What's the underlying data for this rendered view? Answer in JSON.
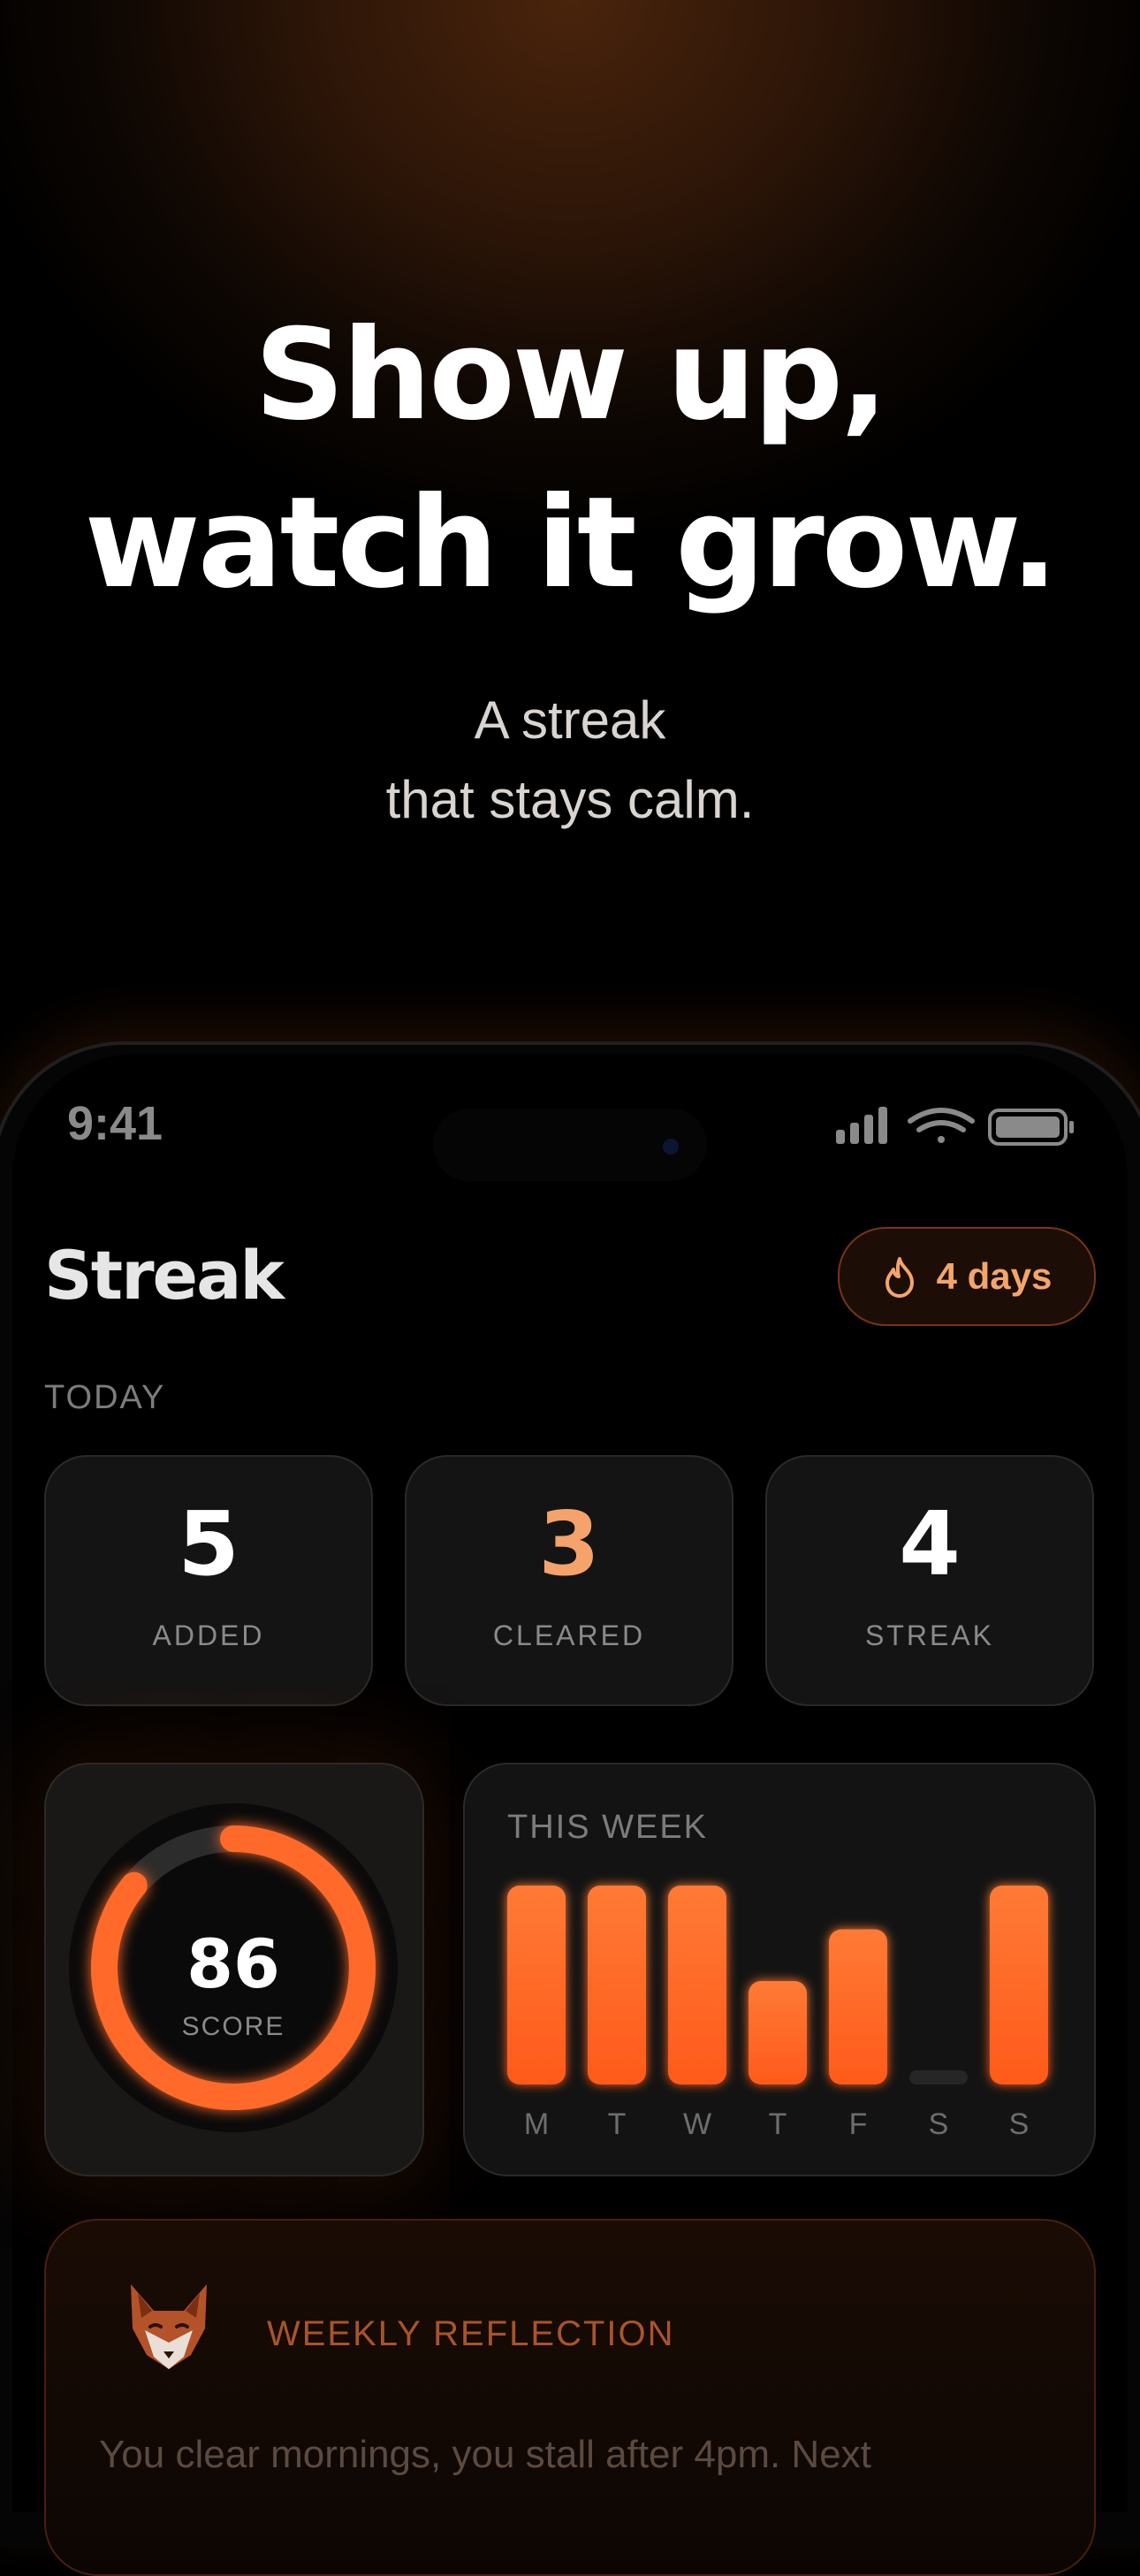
{
  "hero": {
    "headline_line1": "Show up,",
    "headline_line2": "watch it grow.",
    "sub_line1": "A streak",
    "sub_line2": "that stays calm."
  },
  "status_bar": {
    "time": "9:41"
  },
  "app": {
    "title": "Streak",
    "streak_pill": "4 days",
    "section_today": "TODAY"
  },
  "stats": [
    {
      "value": "5",
      "label": "ADDED",
      "color": "#ffffff"
    },
    {
      "value": "3",
      "label": "CLEARED",
      "color": "#f5a36b"
    },
    {
      "value": "4",
      "label": "STREAK",
      "color": "#ffffff"
    }
  ],
  "score": {
    "value": "86",
    "label": "SCORE",
    "fraction": 0.86
  },
  "week": {
    "title": "THIS WEEK",
    "days": [
      "M",
      "T",
      "W",
      "T",
      "F",
      "S",
      "S"
    ],
    "values": [
      1.0,
      1.0,
      1.0,
      0.52,
      0.78,
      0.0,
      1.0
    ]
  },
  "reflection": {
    "title": "WEEKLY REFLECTION",
    "text": "You clear mornings, you stall after 4pm. Next"
  },
  "colors": {
    "accent": "#ff6a2a",
    "accent_light": "#f5a36b"
  }
}
